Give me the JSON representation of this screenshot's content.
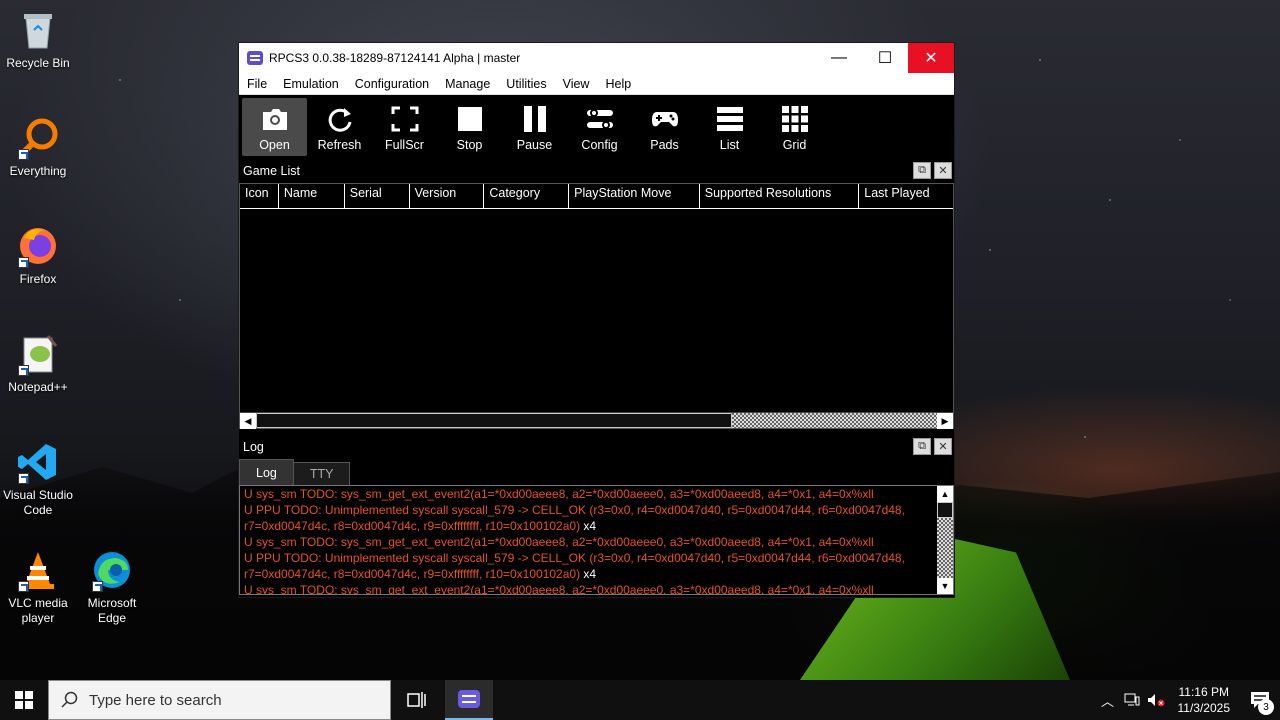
{
  "desktop": {
    "icons": [
      {
        "label": "Recycle Bin"
      },
      {
        "label": "Everything"
      },
      {
        "label": "Firefox"
      },
      {
        "label": "Notepad++"
      },
      {
        "label": "Visual Studio Code"
      },
      {
        "label": "VLC media player"
      },
      {
        "label": "Microsoft Edge"
      }
    ]
  },
  "window": {
    "title": "RPCS3 0.0.38-18289-87124141 Alpha | master",
    "controls": {
      "minimize": "—",
      "maximize": "☐",
      "close": "✕"
    },
    "menu": [
      "File",
      "Emulation",
      "Configuration",
      "Manage",
      "Utilities",
      "View",
      "Help"
    ],
    "toolbar": [
      {
        "label": "Open",
        "icon": "folder-camera-icon"
      },
      {
        "label": "Refresh",
        "icon": "refresh-icon"
      },
      {
        "label": "FullScr",
        "icon": "fullscreen-icon"
      },
      {
        "label": "Stop",
        "icon": "stop-icon"
      },
      {
        "label": "Pause",
        "icon": "pause-icon"
      },
      {
        "label": "Config",
        "icon": "sliders-icon"
      },
      {
        "label": "Pads",
        "icon": "gamepad-icon"
      },
      {
        "label": "List",
        "icon": "list-icon"
      },
      {
        "label": "Grid",
        "icon": "grid-icon"
      }
    ],
    "game_list": {
      "title": "Game List",
      "columns": [
        "Icon",
        "Name",
        "Serial",
        "Version",
        "Category",
        "PlayStation Move",
        "Supported Resolutions",
        "Last Played"
      ]
    },
    "log": {
      "title": "Log",
      "tabs": [
        "Log",
        "TTY"
      ],
      "lines": [
        {
          "text": "U sys_sm TODO: sys_sm_get_ext_event2(a1=*0xd00aeee8, a2=*0xd00aeee0, a3=*0xd00aeed8, a4=*0x1, a4=0x%xll",
          "count": ""
        },
        {
          "text": "U PPU TODO: Unimplemented syscall syscall_579 -> CELL_OK (r3=0x0, r4=0xd0047d40, r5=0xd0047d44, r6=0xd0047d48,",
          "count": ""
        },
        {
          "text": "r7=0xd0047d4c, r8=0xd0047d4c, r9=0xffffffff, r10=0x100102a0)",
          "count": " x4"
        },
        {
          "text": "U sys_sm TODO: sys_sm_get_ext_event2(a1=*0xd00aeee8, a2=*0xd00aeee0, a3=*0xd00aeed8, a4=*0x1, a4=0x%xll",
          "count": ""
        },
        {
          "text": "U PPU TODO: Unimplemented syscall syscall_579 -> CELL_OK (r3=0x0, r4=0xd0047d40, r5=0xd0047d44, r6=0xd0047d48,",
          "count": ""
        },
        {
          "text": "r7=0xd0047d4c, r8=0xd0047d4c, r9=0xffffffff, r10=0x100102a0)",
          "count": " x4"
        },
        {
          "text": "U sys_sm TODO: sys_sm_get_ext_event2(a1=*0xd00aeee8, a2=*0xd00aeee0, a3=*0xd00aeed8, a4=*0x1, a4=0x%xll",
          "count": ""
        }
      ]
    }
  },
  "taskbar": {
    "search_placeholder": "Type here to search",
    "time": "11:16 PM",
    "date": "11/3/2025",
    "notification_count": "3"
  },
  "colors": {
    "accent": "#76b9ed",
    "log_warning": "#e6541c",
    "close_button": "#e81123"
  }
}
